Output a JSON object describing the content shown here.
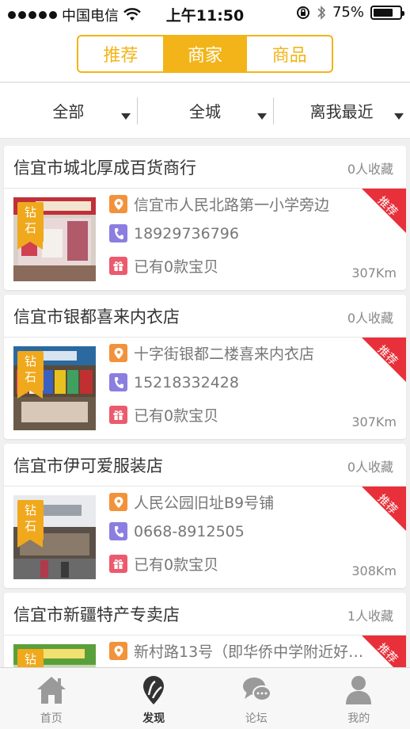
{
  "status_bar": {
    "carrier": "中国电信",
    "time": "上午11:50",
    "battery": "75%",
    "battery_level": 0.75
  },
  "segment": {
    "tabs": [
      {
        "label": "推荐",
        "active": false
      },
      {
        "label": "商家",
        "active": true
      },
      {
        "label": "商品",
        "active": false
      }
    ]
  },
  "filters": [
    "全部",
    "全城",
    "离我最近"
  ],
  "colors": {
    "accent": "#f2b418",
    "ribbon": "#f0a81c",
    "recommend_tag": "#e8303a",
    "location_icon": "#f2923a",
    "phone_icon": "#8a7ee0",
    "gift_icon": "#ec5a6d"
  },
  "stores": [
    {
      "name": "信宜市城北厚成百货商行",
      "favorites": "0人收藏",
      "rank": "钻石",
      "address": "信宜市人民北路第一小学旁边",
      "phone": "18929736796",
      "products": "已有0款宝贝",
      "distance": "307Km",
      "tag": "推荐"
    },
    {
      "name": "信宜市银都喜来内衣店",
      "favorites": "0人收藏",
      "rank": "钻石",
      "address": "十字街银都二楼喜来内衣店",
      "phone": "15218332428",
      "products": "已有0款宝贝",
      "distance": "307Km",
      "tag": "推荐"
    },
    {
      "name": "信宜市伊可爱服装店",
      "favorites": "0人收藏",
      "rank": "钻石",
      "address": "人民公园旧址B9号铺",
      "phone": "0668-8912505",
      "products": "已有0款宝贝",
      "distance": "308Km",
      "tag": "推荐"
    },
    {
      "name": "信宜市新疆特产专卖店",
      "favorites": "1人收藏",
      "rank": "钻石",
      "address": "新村路13号（即华侨中学附近好…",
      "phone": "",
      "products": "",
      "distance": "",
      "tag": "推荐"
    }
  ],
  "tabbar": [
    {
      "label": "首页",
      "icon": "home-icon",
      "active": false
    },
    {
      "label": "发现",
      "icon": "discover-pin-icon",
      "active": true
    },
    {
      "label": "论坛",
      "icon": "forum-chat-icon",
      "active": false
    },
    {
      "label": "我的",
      "icon": "profile-person-icon",
      "active": false
    }
  ]
}
